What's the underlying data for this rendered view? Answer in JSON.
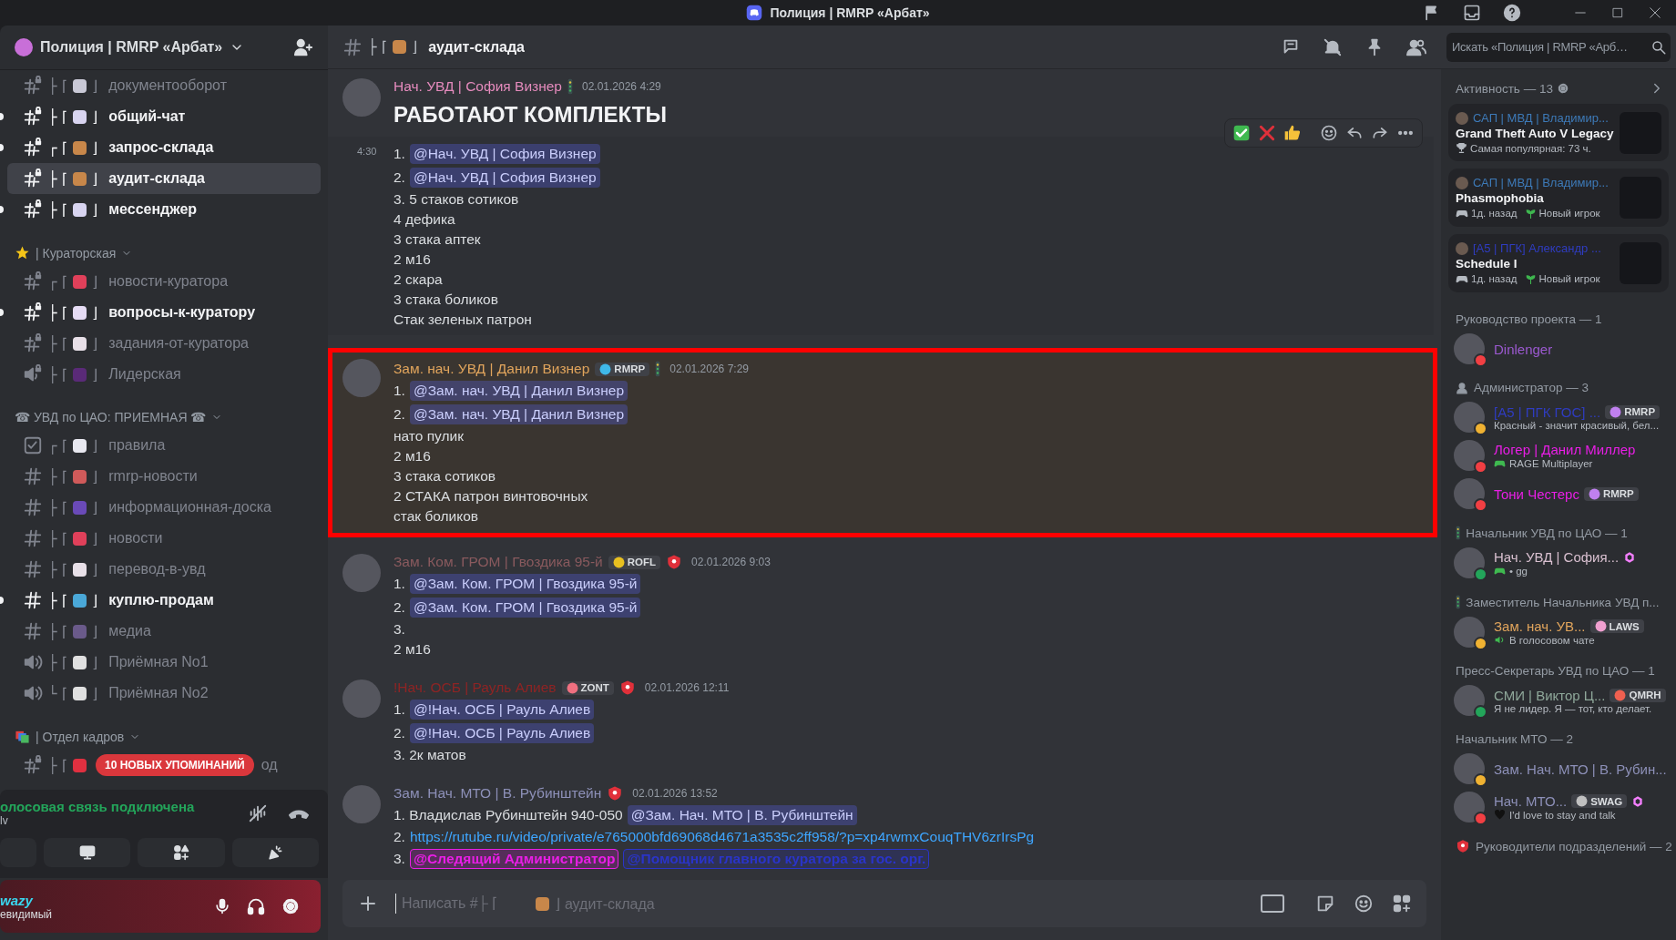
{
  "window": {
    "title": "Полиция | RMRP «Арбат»"
  },
  "sidebar": {
    "server": "Полиция | RMRP «Арбат»",
    "sections": [
      {
        "channels": [
          {
            "kind": "text",
            "locked": true,
            "tree": "├ ⌈",
            "color": "#c9c9d6",
            "close": "⌋",
            "name": "документооборот",
            "unread": false,
            "selected": false
          },
          {
            "kind": "text",
            "locked": true,
            "tree": "├ ⌈",
            "color": "#d8d4f0",
            "close": "⌋",
            "name": "общий-чат",
            "unread": true,
            "selected": false
          },
          {
            "kind": "text",
            "locked": true,
            "tree": "┌ ⌈",
            "color": "#c8874a",
            "close": "⌋",
            "name": "запрос-склада",
            "unread": true,
            "selected": false
          },
          {
            "kind": "text",
            "locked": true,
            "tree": "├ ⌈",
            "color": "#c8874a",
            "close": "⌋",
            "name": "аудит-склада",
            "unread": false,
            "selected": true
          },
          {
            "kind": "text",
            "locked": true,
            "tree": "├ ⌈",
            "color": "#d8d4f0",
            "close": "⌋",
            "name": "мессенджер",
            "unread": true,
            "selected": false
          }
        ]
      },
      {
        "title": "| Кураторская",
        "color": "#f5c518",
        "channels": [
          {
            "kind": "text",
            "locked": true,
            "tree": "┌ ⌈",
            "color": "#e0405a",
            "close": "⌋",
            "name": "новости-куратора",
            "unread": false,
            "selected": false
          },
          {
            "kind": "text",
            "locked": true,
            "tree": "├ ⌈",
            "color": "#e6dcf5",
            "close": "⌋",
            "name": "вопросы-к-куратору",
            "unread": true,
            "selected": false
          },
          {
            "kind": "text",
            "locked": true,
            "tree": "├ ⌈",
            "color": "#e8e0e8",
            "close": "⌋",
            "name": "задания-от-куратора",
            "unread": false,
            "selected": false
          },
          {
            "kind": "voice",
            "locked": true,
            "tree": "├ ⌈",
            "color": "#5a2a78",
            "close": "⌋",
            "name": "Лидерская",
            "unread": false,
            "selected": false
          }
        ]
      },
      {
        "title": "☎ УВД по ЦАО: ПРИЕМНАЯ ☎",
        "channels": [
          {
            "kind": "rules",
            "locked": false,
            "tree": "┌ ⌈",
            "color": "#e8e8f0",
            "close": "⌋",
            "name": "правила",
            "unread": false,
            "selected": false
          },
          {
            "kind": "text",
            "locked": false,
            "tree": "├ ⌈",
            "color": "#d05a5a",
            "close": "⌋",
            "name": "rmrp-новости",
            "unread": false,
            "selected": false
          },
          {
            "kind": "text",
            "locked": false,
            "tree": "├ ⌈",
            "color": "#6a4ab8",
            "close": "⌋",
            "name": "информационная-доска",
            "unread": false,
            "selected": false
          },
          {
            "kind": "text",
            "locked": false,
            "tree": "├ ⌈",
            "color": "#e0405a",
            "close": "⌋",
            "name": "новости",
            "unread": false,
            "selected": false
          },
          {
            "kind": "text",
            "locked": false,
            "tree": "├ ⌈",
            "color": "#e8e0e8",
            "close": "⌋",
            "name": "перевод-в-увд",
            "unread": false,
            "selected": false
          },
          {
            "kind": "text",
            "locked": false,
            "tree": "├ ⌈",
            "color": "#4aa8d8",
            "close": "⌋",
            "name": "куплю-продам",
            "unread": true,
            "selected": false
          },
          {
            "kind": "text",
            "locked": false,
            "tree": "├ ⌈",
            "color": "#6a5a8a",
            "close": "⌋",
            "name": "медиа",
            "unread": false,
            "selected": false
          },
          {
            "kind": "voice",
            "locked": false,
            "tree": "├ ⌈",
            "color": "#e0e0e0",
            "close": "⌋",
            "name": "Приёмная No1",
            "unread": false,
            "selected": false
          },
          {
            "kind": "voice",
            "locked": false,
            "tree": "└ ⌈",
            "color": "#e0e0e0",
            "close": "⌋",
            "name": "Приёмная No2",
            "unread": false,
            "selected": false
          }
        ]
      },
      {
        "title": "| Отдел кадров",
        "color": "#4ab860",
        "channels": [
          {
            "kind": "text",
            "locked": true,
            "tree": "├ ⌈",
            "color": "#e03040",
            "name": "од",
            "unread": false,
            "selected": false
          }
        ]
      }
    ],
    "mentions_pill": "10 НОВЫХ УПОМИНАНИЙ",
    "voice": {
      "status": "олосовая связь подключена",
      "channel": "lv"
    },
    "user": {
      "name": "wazy",
      "status": "евидимый"
    }
  },
  "channel_header": {
    "tree": "├ ⌈",
    "color": "#c8874a",
    "close": "⌋",
    "name": "аудит-склада"
  },
  "search": {
    "placeholder": "Искать «Полиция | RMRP «Арб…"
  },
  "messages": [
    {
      "author": "Нач. УВД | София Визнер",
      "color": "#e58bbd",
      "time": "02.01.2026 4:29",
      "lines": [
        {
          "kind": "heading",
          "parts": [
            {
              "kind": "text",
              "text": "РАБОТАЮТ КОМПЛЕКТЫ"
            }
          ]
        }
      ]
    },
    {
      "time": "4:30",
      "hovered": true,
      "lines": [
        {
          "parts": [
            {
              "kind": "text",
              "text": "1."
            },
            {
              "kind": "mention",
              "text": "@Нач. УВД | София Визнер"
            }
          ]
        },
        {
          "parts": [
            {
              "kind": "text",
              "text": "2."
            },
            {
              "kind": "mention",
              "text": "@Нач. УВД | София Визнер"
            }
          ]
        },
        {
          "parts": [
            {
              "kind": "text",
              "text": "3. 5 стаков сотиков"
            }
          ]
        },
        {
          "parts": [
            {
              "kind": "text",
              "text": "4 дефика"
            }
          ]
        },
        {
          "parts": [
            {
              "kind": "text",
              "text": "3 стака аптек"
            }
          ]
        },
        {
          "parts": [
            {
              "kind": "text",
              "text": "2 м16"
            }
          ]
        },
        {
          "parts": [
            {
              "kind": "text",
              "text": "2 скара"
            }
          ]
        },
        {
          "parts": [
            {
              "kind": "text",
              "text": "3 стака боликов"
            }
          ]
        },
        {
          "parts": [
            {
              "kind": "text",
              "text": "Стак зеленых патрон"
            }
          ]
        }
      ]
    },
    {
      "author": "Зам. нач. УВД | Данил Визнер",
      "color": "#e0a45c",
      "badge": {
        "text": "RMRP",
        "color": "#3fb8e8"
      },
      "time": "02.01.2026 7:29",
      "mentioned": true,
      "highlighted": true,
      "lines": [
        {
          "parts": [
            {
              "kind": "text",
              "text": "1."
            },
            {
              "kind": "mention",
              "text": "@Зам. нач. УВД | Данил Визнер"
            }
          ]
        },
        {
          "parts": [
            {
              "kind": "text",
              "text": "2."
            },
            {
              "kind": "mention",
              "text": "@Зам. нач. УВД | Данил Визнер"
            }
          ]
        },
        {
          "parts": [
            {
              "kind": "text",
              "text": "нато пулик"
            }
          ]
        },
        {
          "parts": [
            {
              "kind": "text",
              "text": "2 м16"
            }
          ]
        },
        {
          "parts": [
            {
              "kind": "text",
              "text": "3 стака сотиков"
            }
          ]
        },
        {
          "parts": [
            {
              "kind": "text",
              "text": "2 СТАКА патрон винтовочных"
            }
          ]
        },
        {
          "parts": [
            {
              "kind": "text",
              "text": "стак боликов"
            }
          ]
        }
      ]
    },
    {
      "author": "Зам. Ком. ГРОМ | Гвоздика 95-й",
      "color": "#8a5a5e",
      "badge": {
        "text": "ROFL",
        "color": "#e8c020"
      },
      "time": "02.01.2026 9:03",
      "lines": [
        {
          "parts": [
            {
              "kind": "text",
              "text": "1."
            },
            {
              "kind": "mention",
              "text": "@Зам. Ком. ГРОМ | Гвоздика 95-й"
            }
          ]
        },
        {
          "parts": [
            {
              "kind": "text",
              "text": "2."
            },
            {
              "kind": "mention",
              "text": "@Зам. Ком. ГРОМ | Гвоздика 95-й"
            }
          ]
        },
        {
          "parts": [
            {
              "kind": "text",
              "text": "3."
            }
          ]
        },
        {
          "parts": [
            {
              "kind": "text",
              "text": "2 м16"
            }
          ]
        }
      ]
    },
    {
      "author": "!Нач. ОСБ | Рауль Алиев",
      "color": "#8e2424",
      "badge": {
        "text": "ZONT",
        "color": "#f07080"
      },
      "time": "02.01.2026 12:11",
      "lines": [
        {
          "parts": [
            {
              "kind": "text",
              "text": "1."
            },
            {
              "kind": "mention",
              "text": "@!Нач. ОСБ | Рауль Алиев"
            }
          ]
        },
        {
          "parts": [
            {
              "kind": "text",
              "text": "2."
            },
            {
              "kind": "mention",
              "text": "@!Нач. ОСБ | Рауль Алиев"
            }
          ]
        },
        {
          "parts": [
            {
              "kind": "text",
              "text": "3. 2к матов"
            }
          ]
        }
      ]
    },
    {
      "author": "Зам. Нач. МТО | В. Рубинштейн",
      "color": "#8d90b8",
      "time": "02.01.2026 13:52",
      "lines": [
        {
          "parts": [
            {
              "kind": "text",
              "text": "1. Владислав Рубинштейн 940-050"
            },
            {
              "kind": "mention",
              "text": "@Зам. Нач. МТО | В. Рубинштейн"
            }
          ]
        },
        {
          "parts": [
            {
              "kind": "text",
              "text": "2."
            },
            {
              "kind": "link",
              "text": "https://rutube.ru/video/private/e765000bfd69068d4671a3535c2ff958/?p=xp4rwmxCouqTHV6zrIrsPg"
            }
          ]
        },
        {
          "parts": [
            {
              "kind": "text",
              "text": "3."
            },
            {
              "kind": "mention",
              "text": "@Следящий Администратор",
              "color": "#e91ee6"
            },
            {
              "kind": "mention",
              "text": "@Помощник главного куратора за гос. орг.",
              "color": "#2a34c8"
            }
          ]
        }
      ]
    }
  ],
  "composer": {
    "placeholder": "Написать #├ ⌈",
    "color": "#c8874a",
    "channel": "⌋ аудит-склада"
  },
  "members": {
    "activity": {
      "title": "Активность — 13",
      "cards": [
        {
          "user": "САП | МВД | Владимир...",
          "color": "#3d7ab8",
          "game": "Grand Theft Auto V Legacy",
          "details": [
            {
              "kind": "trophy",
              "text": "Самая популярная: 73 ч."
            }
          ]
        },
        {
          "user": "САП | МВД | Владимир...",
          "color": "#3d7ab8",
          "game": "Phasmophobia",
          "details": [
            {
              "kind": "controller",
              "text": "1д. назад"
            },
            {
              "kind": "sprout",
              "text": "Новый игрок"
            }
          ]
        },
        {
          "user": "[A5 | ПГК] Александр ...",
          "color": "#2f3cc0",
          "game": "Schedule I",
          "details": [
            {
              "kind": "controller",
              "text": "1д. назад"
            },
            {
              "kind": "sprout",
              "text": "Новый игрок"
            }
          ]
        }
      ]
    },
    "groups": [
      {
        "title": "Руководство проекта — 1",
        "members": [
          {
            "name": "Dinlenger",
            "color": "#9b59d0",
            "kind": "dnd"
          }
        ]
      },
      {
        "title": "Администратор — 3",
        "members": [
          {
            "name": "[A5 | ПГК ГОС] ...",
            "color": "#2f3cc0",
            "kind": "idle",
            "badge": {
              "text": "RMRP",
              "color": "#c080f0"
            },
            "activity": {
              "kind": "text",
              "text": "Красный - значит красивый, бел..."
            }
          },
          {
            "name": "Логер | Данил Миллер",
            "color": "#e91ee6",
            "kind": "dnd",
            "activity": {
              "kind": "controller",
              "text": "RAGE Multiplayer"
            }
          },
          {
            "name": "Тони Честерс",
            "color": "#e91ee6",
            "kind": "dnd",
            "badge": {
              "text": "RMRP",
              "color": "#c080f0"
            }
          }
        ]
      },
      {
        "title": "Начальник УВД по ЦАО — 1",
        "members": [
          {
            "name": "Нач. УВД | София...",
            "color": "#d9c0d0",
            "kind": "online",
            "activity": {
              "kind": "controller",
              "text": "• gg"
            },
            "boosted": true
          }
        ]
      },
      {
        "title": "Заместитель Начальника УВД п...",
        "members": [
          {
            "name": "Зам. нач. УВ...",
            "color": "#e0a45c",
            "kind": "idle",
            "badge": {
              "text": "LAWS",
              "color": "#f0a0d0"
            },
            "activity": {
              "kind": "voice",
              "text": "В голосовом чате"
            }
          }
        ]
      },
      {
        "title": "Пресс-Секретарь УВД по ЦАО — 1",
        "members": [
          {
            "name": "СМИ | Виктор Ц...",
            "color": "#8fa89a",
            "kind": "online",
            "badge": {
              "text": "QMRH",
              "color": "#f06050"
            },
            "activity": {
              "kind": "text",
              "text": "Я не лидер. Я — тот, кто делает."
            }
          }
        ]
      },
      {
        "title": "Начальник МТО — 2",
        "members": [
          {
            "name": "Зам. Нач. МТО | В. Рубин...",
            "color": "#8d90b8",
            "kind": "idle"
          },
          {
            "name": "Нач. МТО...",
            "color": "#8d90b8",
            "kind": "dnd",
            "badge": {
              "text": "SWAG",
              "color": "#c0c0c0"
            },
            "activity": {
              "kind": "heart",
              "text": "I'd love to stay and talk"
            },
            "boosted": true
          }
        ]
      },
      {
        "title": "Руководители подразделений — 2"
      }
    ]
  }
}
